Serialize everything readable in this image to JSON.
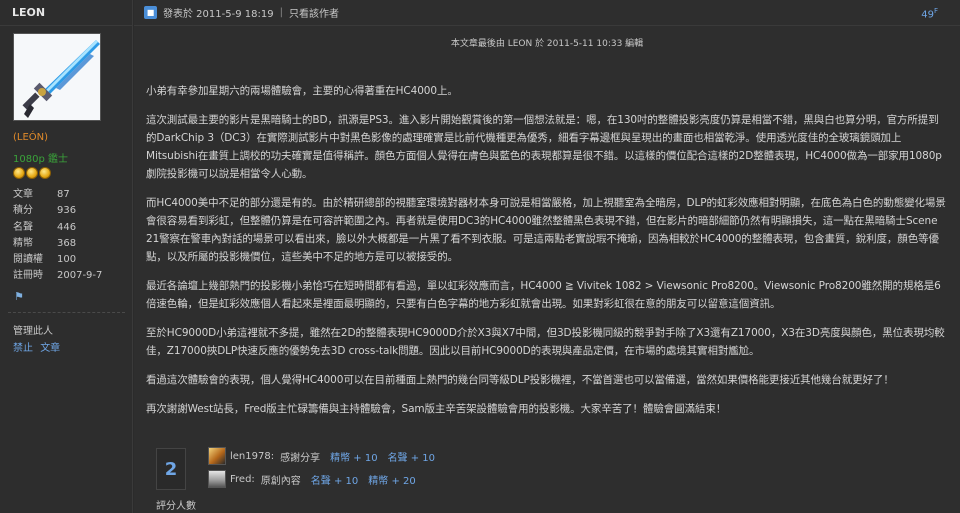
{
  "user": {
    "name": "LEON",
    "rank": "(LEÓN)",
    "title": "1080p 鑑士",
    "stats": [
      {
        "label": "文章",
        "value": "87"
      },
      {
        "label": "積分",
        "value": "936"
      },
      {
        "label": "名聲",
        "value": "446"
      },
      {
        "label": "精幣",
        "value": "368"
      },
      {
        "label": "閱讀權",
        "value": "100"
      },
      {
        "label": "註冊時",
        "value": "2007-9-7"
      }
    ],
    "admin_label": "管理此人",
    "admin_actions": [
      "禁止",
      "文章"
    ]
  },
  "post": {
    "posted_at": "發表於 2011-5-9 18:19",
    "only_author": "只看該作者",
    "floor": "49",
    "floor_sup": "F",
    "edit_note": "本文章最後由 LEON 於 2011-5-11 10:33 編輯",
    "paragraphs": [
      "小弟有幸參加星期六的兩場體驗會，主要的心得著重在HC4000上。",
      "這次測試最主要的影片是黑暗騎士的BD，訊源是PS3。進入影片開始觀賞後的第一個想法就是：嗯，在130吋的整體投影亮度仍算是相當不錯，黑與白也算分明，官方所提到的DarkChip 3（DC3）在實際測試影片中對黑色影像的處理確實是比前代機種更為優秀，細看字幕邊框與呈現出的畫面也相當乾淨。使用透光度佳的全玻璃鏡頭加上Mitsubishi在畫質上調校的功夫確實是值得稱許。顏色方面個人覺得在膚色與藍色的表現都算是很不錯。以這樣的價位配合這樣的2D整體表現，HC4000做為一部家用1080p劇院投影機可以說是相當令人心動。",
      "而HC4000美中不足的部分還是有的。由於精研總部的視聽室環境對器材本身可說是相當嚴格，加上視聽室為全暗房，DLP的虹彩效應相對明顯，在底色為白色的動態變化場景會很容易看到彩虹，但整體仍算是在可容許範圍之內。再者就是使用DC3的HC4000雖然整體黑色表現不錯，但在影片的暗部細節仍然有明顯損失，這一點在黑暗騎士Scene 21警察在警車內對話的場景可以看出來，臉以外大概都是一片黑了看不到衣服。可是這兩點老實說瑕不掩瑜，因為相較於HC4000的整體表現，包含畫質，銳利度，顏色等優點，以及所屬的投影機價位，這些美中不足的地方是可以被接受的。",
      "最近各論壇上幾部熱門的投影機小弟恰巧在短時間都有看過，單以虹彩效應而言，HC4000 ≧ Vivitek 1082 > Viewsonic Pro8200。Viewsonic Pro8200雖然開的規格是6倍速色輪，但是虹彩效應個人看起來是裡面最明顯的，只要有白色字幕的地方彩虹就會出現。如果對彩虹很在意的朋友可以留意這個資訊。",
      "至於HC9000D小弟這裡就不多提，雖然在2D的整體表現HC9000D介於X3與X7中間，但3D投影機同級的競爭對手除了X3還有Z17000，X3在3D亮度與顏色，黑位表現均較佳，Z17000挾DLP快速反應的優勢免去3D cross-talk問題。因此以目前HC9000D的表現與產品定價，在市場的處境其實相對尷尬。",
      "看過這次體驗會的表現，個人覺得HC4000可以在目前種面上熱門的幾台同等級DLP投影機裡，不當首選也可以當備選，當然如果價格能更接近其他幾台就更好了！",
      "再次謝謝West站長，Fred版主忙碌籌備與主持體驗會，Sam版主辛苦架設體驗會用的投影機。大家辛苦了！體驗會圓滿結束！"
    ]
  },
  "rating": {
    "count": "2",
    "label": "評分人數",
    "raters": [
      {
        "name": "len1978:",
        "reason": "感謝分享",
        "scores": [
          "精幣 + 10",
          "名聲 + 10"
        ]
      },
      {
        "name": "Fred:",
        "reason": "原創內容",
        "scores": [
          "名聲 + 10",
          "精幣 + 20"
        ]
      }
    ]
  },
  "colors": {
    "link": "#6fa6e6",
    "rank": "#e08a2a",
    "title": "#3aa33a"
  }
}
